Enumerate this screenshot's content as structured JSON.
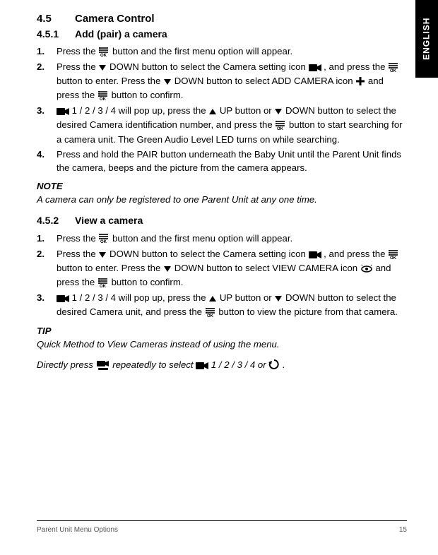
{
  "lang_tab": "ENGLISH",
  "h1": {
    "num": "4.5",
    "title": "Camera Control"
  },
  "h2a": {
    "num": "4.5.1",
    "title": "Add (pair) a camera"
  },
  "h2b": {
    "num": "4.5.2",
    "title": "View a camera"
  },
  "a_steps": [
    {
      "n": "1.",
      "parts": [
        "Press the ",
        "@menuok",
        " button and the first menu option will appear."
      ]
    },
    {
      "n": "2.",
      "parts": [
        "Press the ",
        "@down",
        " DOWN button to select the Camera setting icon ",
        "@cam",
        " , and press the ",
        "@menuok",
        " button to enter. Press the ",
        "@down",
        " DOWN button to select ADD CAMERA icon ",
        "@plus",
        " and press the ",
        "@menuok",
        " button to confirm."
      ]
    },
    {
      "n": "3.",
      "parts": [
        "@cam",
        " 1 / 2 / 3 / 4 will pop up, press the ",
        "@up",
        " UP button or ",
        "@down",
        " DOWN button to select the desired Camera identification number, and press the ",
        "@menuok",
        " button to start searching for a camera unit. The Green Audio Level LED turns on while searching."
      ]
    },
    {
      "n": "4.",
      "parts": [
        "Press and hold the PAIR button underneath the Baby Unit until the Parent Unit finds the camera, beeps and the picture from the camera appears."
      ]
    }
  ],
  "note": {
    "h": "NOTE",
    "t": "A camera can only be registered to one Parent Unit at any one time."
  },
  "b_steps": [
    {
      "n": "1.",
      "parts": [
        "Press the ",
        "@menuok",
        " button and the first menu option will appear."
      ]
    },
    {
      "n": "2.",
      "parts": [
        "Press the ",
        "@down",
        " DOWN button to select the Camera setting icon ",
        "@cam",
        " , and press the ",
        "@menuok",
        " button to enter. Press the ",
        "@down",
        " DOWN button to select VIEW CAMERA icon ",
        "@eye",
        " and press the ",
        "@menuok",
        " button to confirm."
      ]
    },
    {
      "n": "3.",
      "parts": [
        "@cam",
        " 1 / 2 / 3 / 4 will pop up, press the ",
        "@up",
        " UP button or ",
        "@down",
        " DOWN button to select the desired Camera unit, and press the ",
        "@menuok",
        " button to view the picture from that camera."
      ]
    }
  ],
  "tip": {
    "h": "TIP",
    "l1": [
      "Quick Method to View Cameras instead of using the menu."
    ],
    "l2": [
      "Directly press ",
      "@camsel",
      " repeatedly to select ",
      "@cam",
      " 1 / 2 / 3 / 4 or  ",
      "@cycle",
      " ."
    ]
  },
  "footer": {
    "left": "Parent Unit Menu Options",
    "right": "15"
  }
}
